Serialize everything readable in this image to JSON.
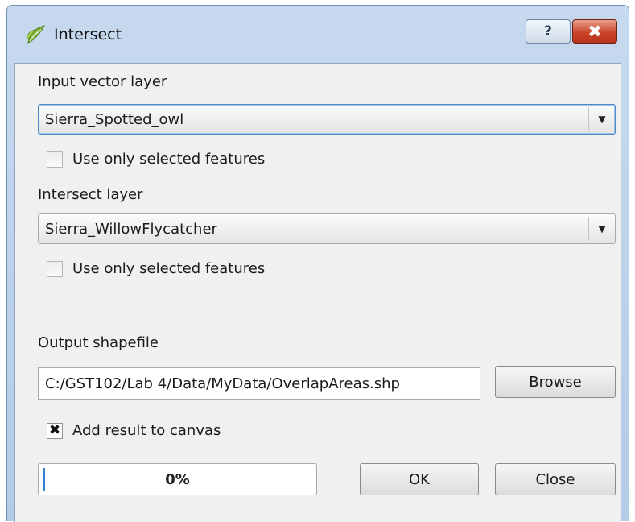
{
  "window": {
    "title": "Intersect",
    "help_glyph": "?",
    "close_glyph": "✖"
  },
  "icons": {
    "app": "qgis-icon",
    "dropdown": "chevron-down-icon",
    "check": "checkmark-icon"
  },
  "input_layer": {
    "label": "Input vector layer",
    "value": "Sierra_Spotted_owl",
    "selected_only": {
      "label": "Use only selected features",
      "checked": false
    }
  },
  "intersect_layer": {
    "label": "Intersect layer",
    "value": "Sierra_WillowFlycatcher",
    "selected_only": {
      "label": "Use only selected features",
      "checked": false
    }
  },
  "output": {
    "label": "Output shapefile",
    "path": "C:/GST102/Lab 4/Data/MyData/OverlapAreas.shp",
    "browse_label": "Browse"
  },
  "add_to_canvas": {
    "label": "Add result to canvas",
    "checked": true,
    "mark": "✖"
  },
  "progress": {
    "value": 0,
    "text": "0%"
  },
  "buttons": {
    "ok": "OK",
    "close": "Close"
  },
  "colors": {
    "titlebar": "#b4cbe6",
    "close_button": "#c9442a",
    "focus_border": "#4f89c9",
    "progress_fill": "#2f7fd6"
  }
}
